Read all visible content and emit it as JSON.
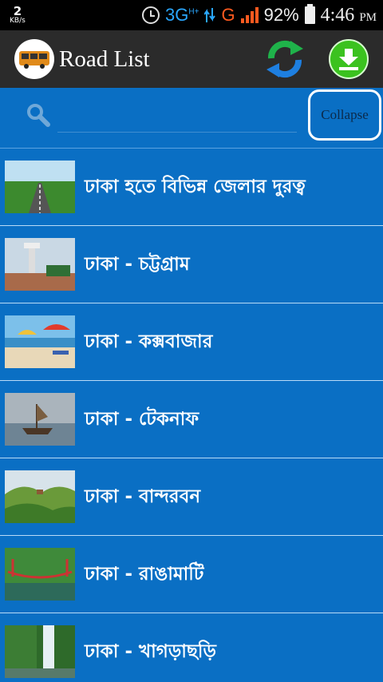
{
  "status_bar": {
    "speed_value": "2",
    "speed_unit": "KB/s",
    "network_3g": "3G",
    "network_h": "H+",
    "network_g": "G",
    "battery_percent": "92%",
    "time": "4:46",
    "ampm": "PM"
  },
  "app_bar": {
    "title": "Road List",
    "logo_icon": "bus-icon",
    "refresh_icon": "refresh-icon",
    "download_icon": "download-icon"
  },
  "search": {
    "placeholder": "",
    "value": "",
    "collapse_label": "Collapse"
  },
  "routes": [
    {
      "label": "ঢাকা হতে বিভিন্ন জেলার দুরত্ব",
      "thumb": "highway"
    },
    {
      "label": "ঢাকা - চট্টগ্রাম",
      "thumb": "tower"
    },
    {
      "label": "ঢাকা - কক্সবাজার",
      "thumb": "beach"
    },
    {
      "label": "ঢাকা - টেকনাফ",
      "thumb": "boat"
    },
    {
      "label": "ঢাকা - বান্দরবন",
      "thumb": "hills"
    },
    {
      "label": "ঢাকা - রাঙামাটি",
      "thumb": "bridge"
    },
    {
      "label": "ঢাকা - খাগড়াছড়ি",
      "thumb": "waterfall"
    }
  ]
}
